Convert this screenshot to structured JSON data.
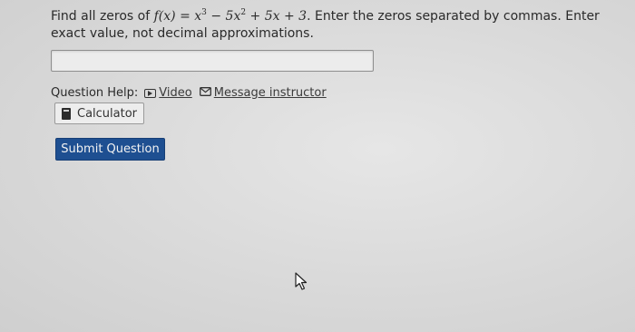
{
  "question": {
    "prefix": "Find all zeros of ",
    "function": {
      "fx": "f(x)",
      "eq": " = ",
      "t1": "x",
      "t1_exp": "3",
      "op1": " − 5",
      "t2": "x",
      "t2_exp": "2",
      "rest": " + 5x + 3"
    },
    "suffix": ". Enter the zeros separated by commas. Enter exact value, not decimal approximations."
  },
  "answer": {
    "value": "",
    "placeholder": ""
  },
  "help": {
    "label": "Question Help:",
    "video_label": "Video",
    "message_label": "Message instructor"
  },
  "calculator": {
    "label": "Calculator"
  },
  "submit": {
    "label": "Submit Question"
  },
  "colors": {
    "submit_bg": "#1e4f91",
    "background": "#dcdcdc"
  },
  "icons": {
    "video": "video-play-icon",
    "message": "envelope-icon",
    "calculator": "calculator-icon",
    "cursor": "mouse-pointer-icon"
  }
}
